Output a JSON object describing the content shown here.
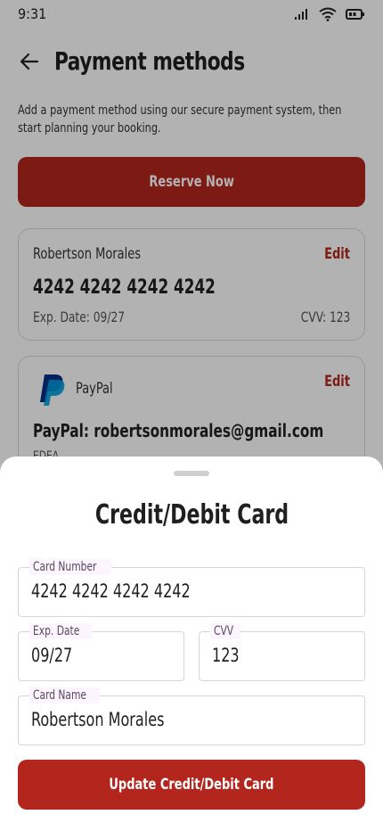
{
  "status_bar": {
    "time": "9:31"
  },
  "header": {
    "title": "Payment methods"
  },
  "intro": {
    "text": "Add a payment method using our secure payment system, then start planning your booking."
  },
  "reserve_button": {
    "label": "Reserve Now"
  },
  "cards": [
    {
      "holder": "Robertson Morales",
      "edit_label": "Edit",
      "number": "4242 4242 4242 4242",
      "exp": "Exp. Date: 09/27",
      "cvv": "CVV: 123"
    }
  ],
  "paypal": {
    "name": "PayPal",
    "edit_label": "Edit",
    "email": "PayPal: robertsonmorales@gmail.com",
    "extra": "EDEA"
  },
  "sheet": {
    "title": "Credit/Debit Card",
    "card_number": {
      "label": "Card Number",
      "value": "4242 4242 4242 4242"
    },
    "exp_date": {
      "label": "Exp. Date",
      "value": "09/27"
    },
    "cvv": {
      "label": "CVV",
      "value": "123"
    },
    "card_name": {
      "label": "Card Name",
      "value": "Robertson Morales"
    },
    "update_button": "Update Credit/Debit Card"
  },
  "colors": {
    "accent": "#b3261e",
    "paypal_dark": "#003087",
    "paypal_light": "#009cde"
  },
  "icons": [
    "signal-icon",
    "wifi-icon",
    "battery-icon",
    "back-arrow-icon",
    "paypal-logo-icon"
  ]
}
